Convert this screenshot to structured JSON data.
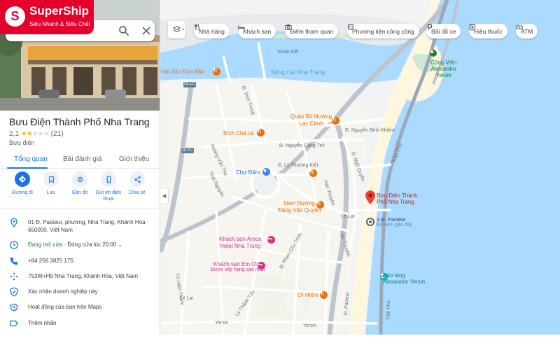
{
  "logo": {
    "name": "SuperShip",
    "slogan": "Siêu Nhanh & Siêu Chất"
  },
  "search": {
    "query_tail": "ng"
  },
  "place": {
    "title": "Bưu Điện Thành Phố Nha Trang",
    "rating": "2,1",
    "rating_fraction": 0.42,
    "reviews": "(21)",
    "category": "Bưu điện"
  },
  "tabs": [
    "Tổng quan",
    "Bài đánh giá",
    "Giới thiệu"
  ],
  "actions": [
    {
      "label": "Đường đi",
      "icon": "directions-icon"
    },
    {
      "label": "Lưu",
      "icon": "bookmark-icon"
    },
    {
      "label": "Gần đó",
      "icon": "nearby-icon"
    },
    {
      "label": "Gửi tới điện thoại",
      "icon": "phone-icon"
    },
    {
      "label": "Chia sẻ",
      "icon": "share-icon"
    }
  ],
  "info": {
    "address": "01 Đ. Pasteur, phường, Nha Trang, Khánh Hòa 650000, Việt Nam",
    "hours_status": "Đang mở cửa",
    "hours_close": " · Đóng cửa lúc 20:00",
    "phone": "+84 258 3825 175",
    "plus_code": "753W+H9 Nha Trang, Khánh Hòa, Việt Nam",
    "verify": "Xác nhận doanh nghiệp này",
    "activity": "Hoạt động của bạn trên Maps",
    "add_label": "Thêm nhãn"
  },
  "chips": [
    {
      "label": "Nhà hàng",
      "icon": "restaurant-icon"
    },
    {
      "label": "Khách sạn",
      "icon": "hotel-icon"
    },
    {
      "label": "Điểm tham quan",
      "icon": "camera-icon"
    },
    {
      "label": "Phương tiện công cộng",
      "icon": "transit-icon"
    },
    {
      "label": "Bãi đỗ xe",
      "icon": "parking-icon"
    },
    {
      "label": "Hiệu thuốc",
      "icon": "pharmacy-icon"
    },
    {
      "label": "ATM",
      "icon": "atm-icon"
    }
  ],
  "map": {
    "water_label": "Sông Cái Nha Trang",
    "roads": {
      "doan_kiet": "Đoàn Kết",
      "ql1c_a": "QL1C",
      "ql1c_b": "QL1C",
      "nguyen_binh_khiem": "Đ. Nguyễn Bỉnh Khiêm",
      "nguyen_cong_tru": "Đ. Nguyễn Công Trứ",
      "ly_thuong_kiet": "Đ. Lý Thường Kiệt",
      "tran_phu": "Trần Phú",
      "tran_phu_2": "Trần Phú",
      "phan_chu_trinh": "Đ. Phan Chu Trinh",
      "han_thuyen": "Hàn Thuyên",
      "han_thuyen_2": "Hàn Thuyên",
      "ngo_quyen": "Đ. Ngô Quyền",
      "ly_thanh_ton": "Lý Thánh Tôn",
      "thai_nguyen": "Thái Nguyên",
      "yersin": "Yersin",
      "yersin_2": "Yersin",
      "le_loi": "Lê Lợi",
      "pasteur": "Đ. Pasteur",
      "le_lai": "Lê Lai",
      "sinh_trung": "Đ. Sinh Trung",
      "to_hien_thanh": "Tô Hiến Thành",
      "phuong_chung": "Hoàng Văn Thụ"
    },
    "pois": {
      "hai_san": "Hải Sản Đón Bão",
      "quan_bo": "Quán Bò Nướng\nLạc Cảnh",
      "bich_cha_ca": "Bích Chả cá",
      "cho_dam": "Chợ Đầm",
      "nem_nuong": "Nem Nướng\nĐặng Văn Quyên",
      "khach_san_areca": "Khách sạn Areca\nHotel Nha Trang",
      "khach_san_em_oi": "Khách sạn Em Ơi",
      "em_oi_sub": "Được xếp hạng cao nhất",
      "oi_hiem": "Ơi Hiểm",
      "bao_tang_yersin": "Bảo tàng\nAlexandre Yersin",
      "cong_vien": "Công Viên\nAlexandre\nYersin",
      "buu_dien": "Bưu Điện Thành\nPhố Nha Trang",
      "pasteur_1": "1 Đ. Pasteur",
      "pasteur_1_sub": "Đã xem gần đây"
    }
  },
  "colors": {
    "accent": "#1a73e8",
    "brand": "#e4002b",
    "pin": "#ea4335",
    "water": "#aadaff"
  }
}
